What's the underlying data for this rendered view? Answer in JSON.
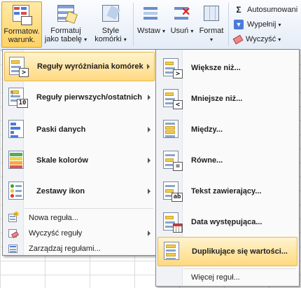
{
  "ribbon": {
    "conditional_formatting": "Formatow.\nwarunk.",
    "format_as_table": "Formatuj\njako tabelę",
    "cell_styles": "Style\nkomórki",
    "insert": "Wstaw",
    "delete": "Usuń",
    "format": "Format",
    "autosum": "Autosumowani",
    "fill": "Wypełnij",
    "clear": "Wyczyść"
  },
  "menu": {
    "items": [
      {
        "label": "Reguły wyróżniania komórek",
        "icon": "highlight-cells-rules-icon",
        "highlighted": true
      },
      {
        "label": "Reguły pierwszych/ostatnich",
        "icon": "top-bottom-rules-icon"
      },
      {
        "label": "Paski danych",
        "icon": "data-bars-icon"
      },
      {
        "label": "Skale kolorów",
        "icon": "color-scales-icon"
      },
      {
        "label": "Zestawy ikon",
        "icon": "icon-sets-icon"
      }
    ],
    "small_items": [
      {
        "label": "Nowa reguła...",
        "icon": "new-rule-icon"
      },
      {
        "label": "Wyczyść reguły",
        "icon": "clear-rules-icon"
      },
      {
        "label": "Zarządzaj regułami...",
        "icon": "manage-rules-icon"
      }
    ]
  },
  "submenu": {
    "items": [
      {
        "label": "Większe niż...",
        "icon": "greater-than-icon"
      },
      {
        "label": "Mniejsze niż...",
        "icon": "less-than-icon"
      },
      {
        "label": "Między...",
        "icon": "between-icon"
      },
      {
        "label": "Równe...",
        "icon": "equal-to-icon"
      },
      {
        "label": "Tekst zawierający...",
        "icon": "text-contains-icon"
      },
      {
        "label": "Data występująca...",
        "icon": "date-occurring-icon"
      },
      {
        "label": "Duplikujące się wartości...",
        "icon": "duplicate-values-icon",
        "highlighted": true
      }
    ],
    "more": "Więcej reguł..."
  },
  "icon_text": {
    "top10": "10",
    "greater": ">",
    "less": "<",
    "equal": "=",
    "text": "ab",
    "sigma": "Σ"
  },
  "colors": {
    "highlight_start": "#fff3cf",
    "highlight_end": "#ffd980",
    "accent_yellow": "#f2c94c",
    "accent_blue": "#8ba4c8"
  }
}
